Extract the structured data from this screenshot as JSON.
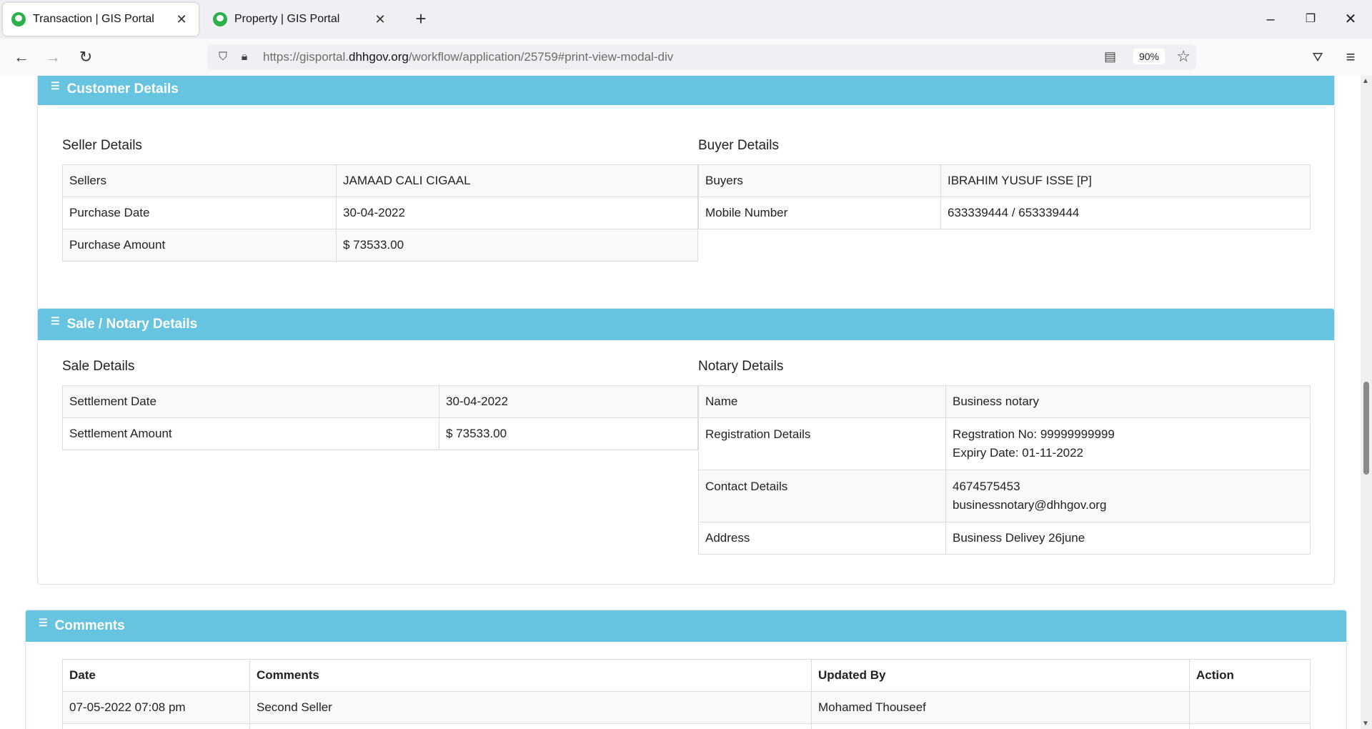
{
  "browser": {
    "tabs": [
      {
        "title": "Transaction | GIS Portal",
        "active": true
      },
      {
        "title": "Property | GIS Portal",
        "active": false
      }
    ],
    "url": {
      "prefix": "https://gisportal.",
      "domain": "dhhgov.org",
      "path": "/workflow/application/25759#print-view-modal-div"
    },
    "zoom": "90%"
  },
  "customer": {
    "header": "Customer Details",
    "seller": {
      "title": "Seller Details",
      "rows": [
        {
          "label": "Sellers",
          "value": "JAMAAD CALI CIGAAL"
        },
        {
          "label": "Purchase Date",
          "value": "30-04-2022"
        },
        {
          "label": "Purchase Amount",
          "value": "$ 73533.00"
        }
      ]
    },
    "buyer": {
      "title": "Buyer Details",
      "rows": [
        {
          "label": "Buyers",
          "value": "IBRAHIM YUSUF ISSE [P]"
        },
        {
          "label": "Mobile Number",
          "value": "633339444 / 653339444"
        }
      ]
    }
  },
  "sale": {
    "header": "Sale / Notary Details",
    "sale_details": {
      "title": "Sale Details",
      "rows": [
        {
          "label": "Settlement Date",
          "value": "30-04-2022"
        },
        {
          "label": "Settlement Amount",
          "value": "$ 73533.00"
        }
      ]
    },
    "notary": {
      "title": "Notary Details",
      "name_label": "Name",
      "name_value": "Business notary",
      "registration_label": "Registration Details",
      "registration_no": "Regstration No: 99999999999",
      "expiry": "Expiry Date: 01-11-2022",
      "contact_label": "Contact Details",
      "phone": "4674575453",
      "email": "businessnotary@dhhgov.org",
      "address_label": "Address",
      "address_value": "Business Delivey 26june"
    }
  },
  "comments": {
    "header": "Comments",
    "columns": [
      "Date",
      "Comments",
      "Updated By",
      "Action"
    ],
    "rows": [
      {
        "date": "07-05-2022 07:08 pm",
        "comment": "Second Seller",
        "updated_by": "Mohamed Thouseef",
        "action": ""
      }
    ]
  }
}
